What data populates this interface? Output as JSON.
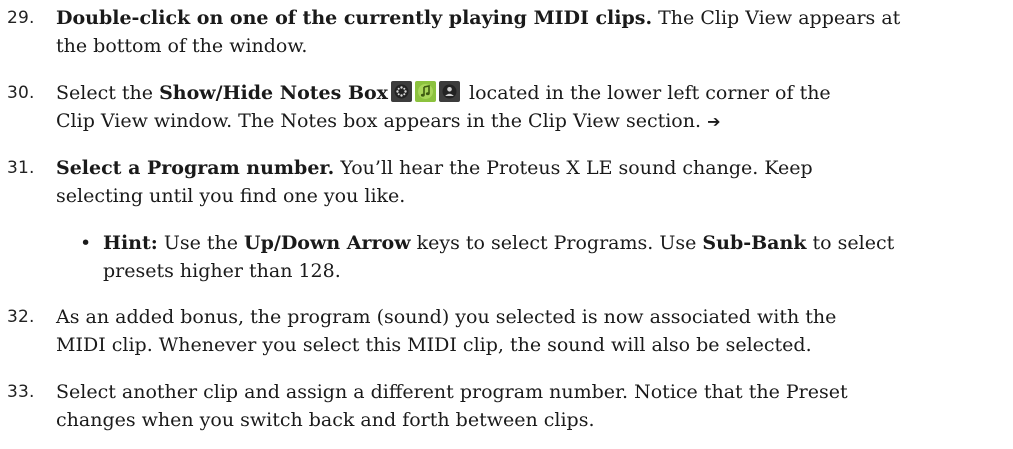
{
  "steps": [
    {
      "number": "29.",
      "line1_bold": "Double-click on one of the currently playing MIDI clips.",
      "line1_rest": " The Clip View appears at",
      "line2": "the bottom of the window."
    },
    {
      "number": "30.",
      "line1_pre": "Select the ",
      "line1_bold": "Show/Hide Notes Box",
      "line1_post": " located in the lower left corner of the",
      "line2": "Clip View window. The Notes box appears in the Clip View section.",
      "arrow": "➔",
      "icons": [
        "dot-grid-icon",
        "music-note-icon",
        "person-icon"
      ]
    },
    {
      "number": "31.",
      "line1_bold": "Select a Program number.",
      "line1_rest": " You’ll hear the Proteus X LE sound change. Keep",
      "line2": "selecting until you find one you like."
    },
    {
      "bullet": "•",
      "hint_bold": "Hint:",
      "hint_a": " Use the ",
      "hint_b_bold": "Up/Down Arrow",
      "hint_c": " keys to select Programs. Use ",
      "hint_d_bold": "Sub-Bank",
      "hint_e": " to select",
      "line2": "presets higher than 128."
    },
    {
      "number": "32.",
      "line1": "As an added bonus, the program (sound) you selected is now associated with the",
      "line2": "MIDI clip. Whenever you select this MIDI clip, the sound will also be selected."
    },
    {
      "number": "33.",
      "line1": "Select another clip and assign a different program number. Notice that the Preset",
      "line2": "changes when you switch back and forth between clips."
    }
  ]
}
